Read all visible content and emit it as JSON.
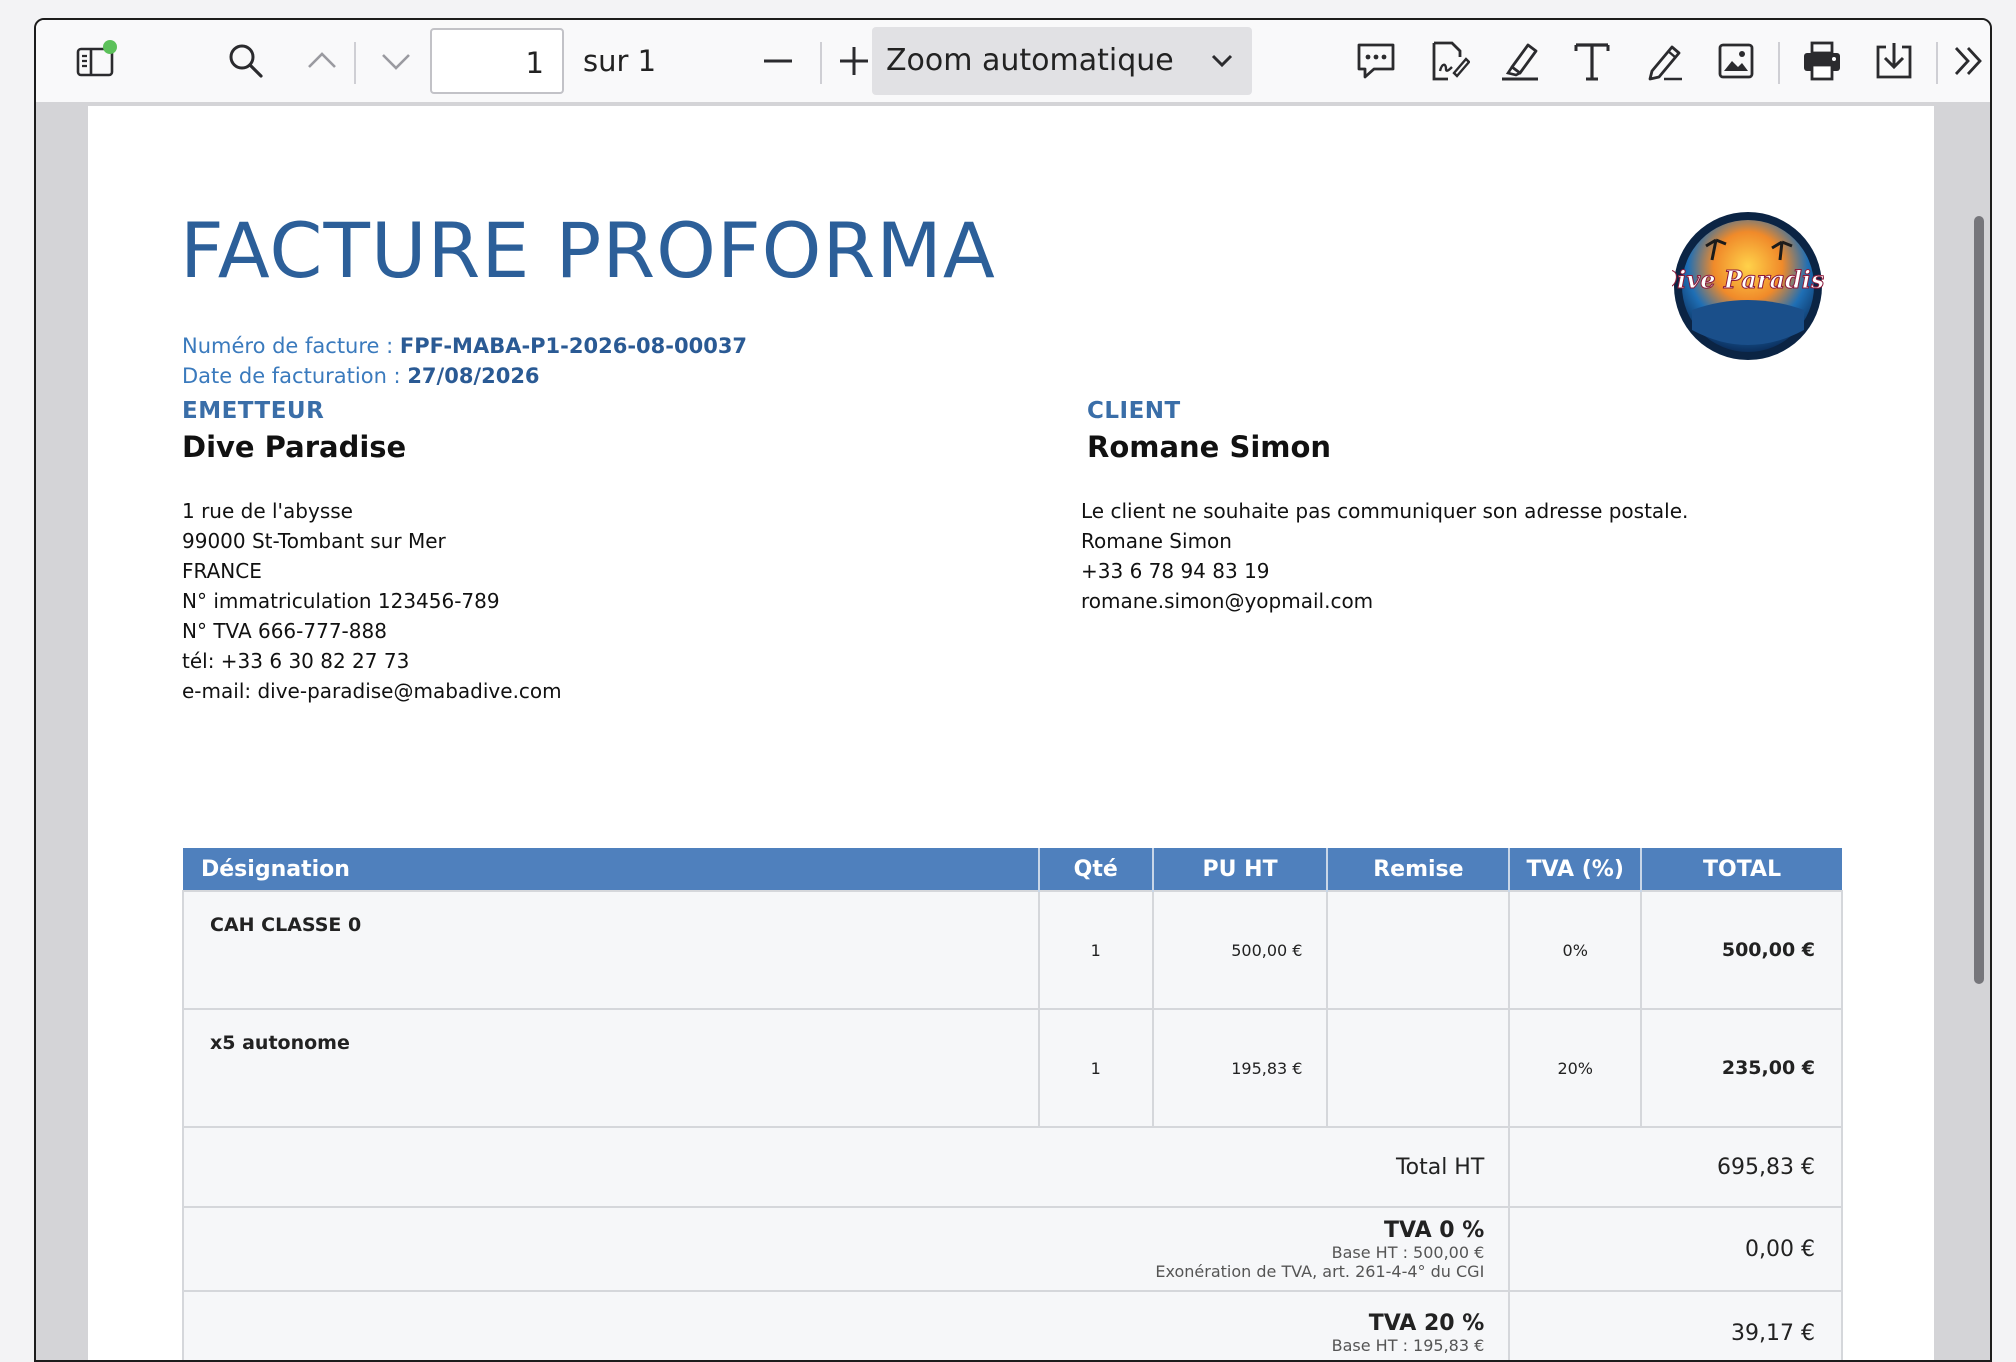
{
  "toolbar": {
    "page_current": "1",
    "page_of": "sur 1",
    "zoom": "Zoom automatique",
    "icons": [
      "sidebar-toggle-icon",
      "search-icon",
      "chevron-up-icon",
      "chevron-down-icon",
      "zoom-out-icon",
      "zoom-in-icon",
      "comment-icon",
      "signature-icon",
      "highlight-icon",
      "text-icon",
      "draw-icon",
      "image-icon",
      "print-icon",
      "download-icon",
      "more-tools-icon"
    ],
    "notification_color": "#5cc15a"
  },
  "invoice": {
    "title": "FACTURE PROFORMA",
    "number_label": "Numéro de facture : ",
    "number_value": "FPF-MABA-P1-2026-08-00037",
    "date_label": "Date de facturation : ",
    "date_value": "27/08/2026",
    "logo_text": "Dive Paradise",
    "emitter": {
      "label": "EMETTEUR",
      "name": "Dive Paradise",
      "lines": [
        "1 rue de l'abysse",
        "99000 St-Tombant sur Mer",
        "FRANCE",
        "N° immatriculation 123456-789",
        "N° TVA 666-777-888",
        "tél: +33 6 30 82 27 73",
        "e-mail: dive-paradise@mabadive.com"
      ]
    },
    "client": {
      "label": "CLIENT",
      "name": "Romane Simon",
      "lines": [
        "Le client ne souhaite pas communiquer son adresse postale.",
        "Romane Simon",
        "+33 6 78 94 83 19",
        "romane.simon@yopmail.com"
      ]
    },
    "table": {
      "headers": [
        "Désignation",
        "Qté",
        "PU HT",
        "Remise",
        "TVA (%)",
        "TOTAL"
      ],
      "rows": [
        {
          "designation": "CAH CLASSE 0",
          "qty": "1",
          "pu": "500,00 €",
          "remise": "",
          "tva": "0%",
          "total": "500,00 €"
        },
        {
          "designation": "x5 autonome",
          "qty": "1",
          "pu": "195,83 €",
          "remise": "",
          "tva": "20%",
          "total": "235,00 €"
        }
      ],
      "summary": {
        "total_ht_label": "Total HT",
        "total_ht_value": "695,83 €",
        "tva0_label": "TVA 0 %",
        "tva0_base": "Base HT : 500,00 €",
        "tva0_note": "Exonération de TVA, art. 261-4-4° du CGI",
        "tva0_value": "0,00 €",
        "tva20_label": "TVA 20 %",
        "tva20_base": "Base HT : 195,83 €",
        "tva20_value": "39,17 €"
      }
    },
    "colors": {
      "accent": "#2c5f99",
      "header_bg": "#4f80bd"
    }
  }
}
